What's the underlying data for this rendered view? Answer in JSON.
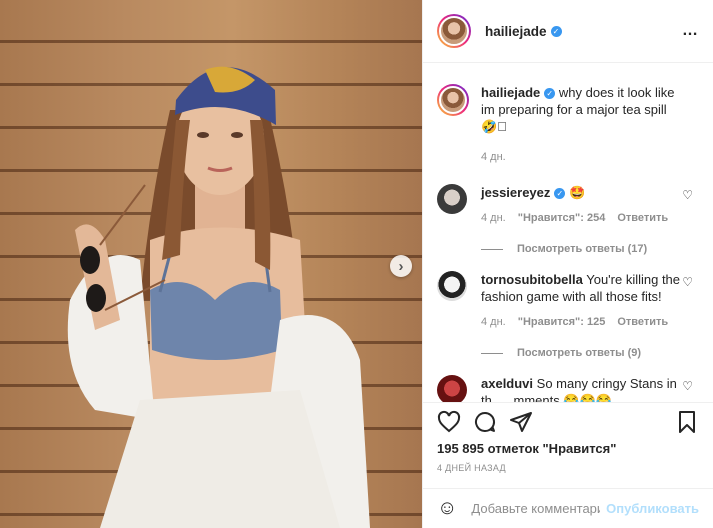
{
  "post": {
    "author": "hailiejade",
    "more_icon": "…"
  },
  "caption": {
    "username": "hailiejade",
    "text": "why does it look like im preparing for a major tea spill 🤣\u0000",
    "time": "4 дн."
  },
  "comments": [
    {
      "username": "jessiereyez",
      "verified": true,
      "text": "🤩",
      "time": "4 дн.",
      "likes": "\"Нравится\": 254",
      "reply": "Ответить",
      "view_replies": "Посмотреть ответы (17)"
    },
    {
      "username": "tornosubitobella",
      "verified": false,
      "text": "You're killing the fashion game with all those fits!",
      "time": "4 дн.",
      "likes": "\"Нравится\": 125",
      "reply": "Ответить",
      "view_replies": "Посмотреть ответы (9)"
    },
    {
      "username": "axelduvi",
      "verified": false,
      "text": "So many cringy Stans in th... ..mments 😂😂😂",
      "time": "",
      "likes": "",
      "reply": "",
      "view_replies": ""
    }
  ],
  "likes_text": "195 895 отметок \"Нравится\"",
  "posted_ago": "4 ДНЕЙ НАЗАД",
  "comment_input": {
    "placeholder": "Добавьте комментарий...",
    "post_label": "Опубликовать"
  },
  "icons": {
    "like": "heart-icon",
    "comment": "comment-icon",
    "share": "share-icon",
    "save": "bookmark-icon",
    "emoji": "smile-icon",
    "next": "chevron-right-icon"
  },
  "colors": {
    "verified": "#3897f0",
    "post_button": "#b2dffc",
    "muted_text": "#8e8e8e"
  }
}
